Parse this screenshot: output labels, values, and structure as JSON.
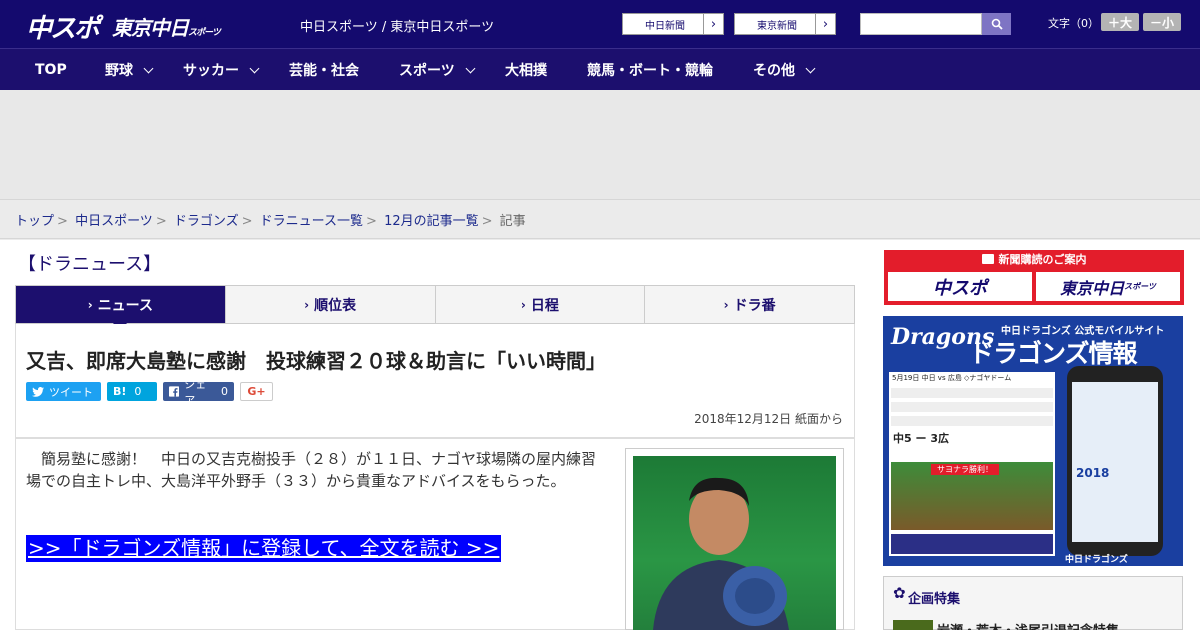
{
  "header": {
    "logo_main": "中スポ",
    "logo_tokyo": "東京中日",
    "logo_tokyo_small": "スポーツ",
    "site_desc": "中日スポーツ / 東京中日スポーツ",
    "link_chunichi": "中日新聞",
    "link_tokyo": "東京新聞",
    "search_value": "",
    "font_label": "文字（0）",
    "font_bigger": "＋大",
    "font_smaller": "－小"
  },
  "nav": {
    "items": [
      {
        "label": "TOP"
      },
      {
        "label": "野球"
      },
      {
        "label": "サッカー"
      },
      {
        "label": "芸能・社会"
      },
      {
        "label": "スポーツ"
      },
      {
        "label": "大相撲"
      },
      {
        "label": "競馬・ボート・競輪"
      },
      {
        "label": "その他"
      }
    ]
  },
  "breadcrumb": {
    "items": [
      "トップ",
      "中日スポーツ",
      "ドラゴンズ",
      "ドラニュース一覧",
      "12月の記事一覧"
    ],
    "current": "記事",
    "separator": ">"
  },
  "section_title": "【ドラニュース】",
  "tabs": [
    {
      "label": "ニュース"
    },
    {
      "label": "順位表"
    },
    {
      "label": "日程"
    },
    {
      "label": "ドラ番"
    }
  ],
  "article": {
    "headline": "又吉、即席大島塾に感謝　投球練習２０球＆助言に「いい時間」",
    "date": "2018年12月12日 紙面から",
    "body": "　簡易塾に感謝！　中日の又吉克樹投手（２８）が１１日、ナゴヤ球場隣の屋内練習場での自主トレ中、大島洋平外野手（３３）から貴重なアドバイスをもらった。",
    "read_more": ">>「ドラゴンズ情報」に登録して、全文を読む >>"
  },
  "share": {
    "tweet": "ツイート",
    "hatena_label": "B!",
    "hatena_count": "0",
    "fb_label": "シェア",
    "fb_count": "0",
    "gplus": "G+"
  },
  "sidebar": {
    "subscribe_title": "新聞購読のご案内",
    "subscribe_chunspo": "中スポ",
    "subscribe_tokyo": "東京中日",
    "subscribe_tokyo_small": "スポーツ",
    "dragons_logo": "Dragons",
    "dragons_sub": "中日ドラゴンズ  公式モバイルサイト",
    "dragons_title": "ドラゴンズ情報",
    "dragons_game": "5月19日 中日 vs 広島 ◇ナゴヤドーム",
    "dragons_score": "中5 ー 3広",
    "dragons_sayonara": "サヨナラ勝利！",
    "dragons_year": "2018",
    "dragons_footer": "中日ドラゴンズ",
    "feature_title": "企画特集",
    "feature_item": "岩瀬・荒木・浅尾引退記念特集"
  },
  "colors": {
    "header_bg": "#140a6e",
    "nav_bg": "#1c0f6e",
    "accent_red": "#e31d2b",
    "read_more_bg": "#0000ff",
    "twitter": "#1da1f2",
    "hatena": "#00a4de",
    "facebook": "#3b5998"
  }
}
